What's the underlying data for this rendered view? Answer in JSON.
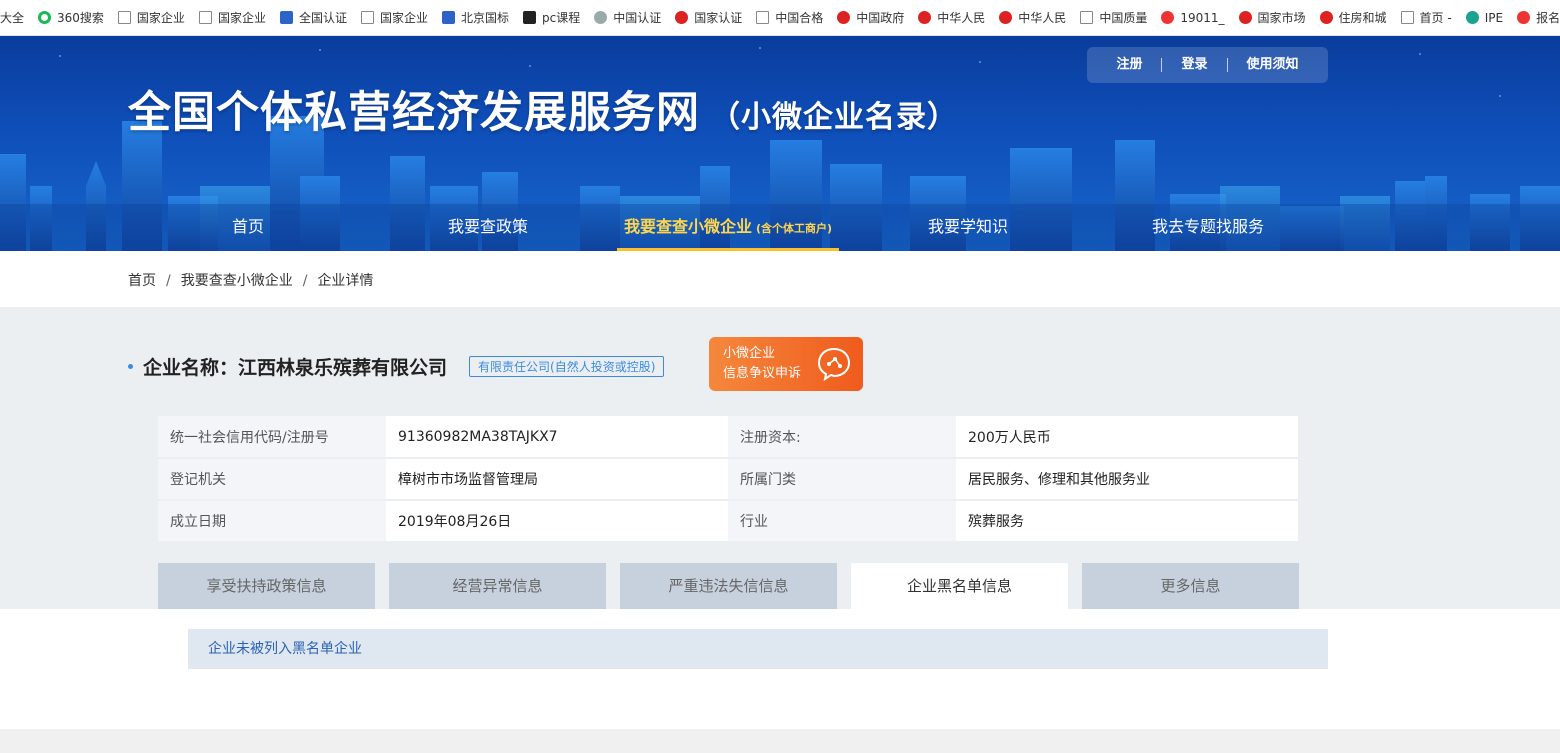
{
  "bookmarks": [
    {
      "label": "大全",
      "icon": "none-icon"
    },
    {
      "label": "360搜索",
      "icon": "360-icon"
    },
    {
      "label": "国家企业",
      "icon": "page-icon"
    },
    {
      "label": "国家企业",
      "icon": "page-icon"
    },
    {
      "label": "全国认证",
      "icon": "blue-icon"
    },
    {
      "label": "国家企业",
      "icon": "page-icon"
    },
    {
      "label": "北京国标",
      "icon": "blue-icon"
    },
    {
      "label": "pc课程",
      "icon": "dark-icon"
    },
    {
      "label": "中国认证",
      "icon": "grey-icon"
    },
    {
      "label": "国家认证",
      "icon": "seal-icon"
    },
    {
      "label": "中国合格",
      "icon": "page-icon"
    },
    {
      "label": "中国政府",
      "icon": "seal-icon"
    },
    {
      "label": "中华人民",
      "icon": "seal-icon"
    },
    {
      "label": "中华人民",
      "icon": "seal-icon"
    },
    {
      "label": "中国质量",
      "icon": "page-icon"
    },
    {
      "label": "19011_",
      "icon": "red-icon"
    },
    {
      "label": "国家市场",
      "icon": "seal-icon"
    },
    {
      "label": "住房和城",
      "icon": "seal-icon"
    },
    {
      "label": "首页 -",
      "icon": "page-icon"
    },
    {
      "label": "IPE",
      "icon": "teal-icon"
    },
    {
      "label": "报名首",
      "icon": "red-icon"
    }
  ],
  "header": {
    "title": "全国个体私营经济发展服务网",
    "subtitle": "（小微企业名录）",
    "toplinks": {
      "register": "注册",
      "login": "登录",
      "guide": "使用须知"
    }
  },
  "nav": {
    "home": "首页",
    "policy": "我要查政策",
    "enterprise": "我要查查小微企业",
    "enterprise_note": "(含个体工商户)",
    "learn": "我要学知识",
    "topic": "我去专题找服务"
  },
  "breadcrumb": {
    "home": "首页",
    "search": "我要查查小微企业",
    "detail": "企业详情"
  },
  "company": {
    "label": "企业名称：江西林泉乐殡葬有限公司",
    "type": "有限责任公司(自然人投资或控股)",
    "appeal_line1": "小微企业",
    "appeal_line2": "信息争议申诉"
  },
  "info": {
    "credit_code_label": "统一社会信用代码/注册号",
    "credit_code_value": "91360982MA38TAJKX7",
    "capital_label": "注册资本:",
    "capital_value": "200万人民币",
    "authority_label": "登记机关",
    "authority_value": "樟树市市场监督管理局",
    "category_label": "所属门类",
    "category_value": "居民服务、修理和其他服务业",
    "date_label": "成立日期",
    "date_value": "2019年08月26日",
    "industry_label": "行业",
    "industry_value": "殡葬服务"
  },
  "tabs": {
    "support": "享受扶持政策信息",
    "abnormal": "经营异常信息",
    "illegal": "严重违法失信信息",
    "blacklist": "企业黑名单信息",
    "more": "更多信息",
    "active": "blacklist"
  },
  "notice": {
    "text": "企业未被列入黑名单企业"
  },
  "colors": {
    "accent": "#3c8be0",
    "nav_active": "#ffd64d",
    "appeal": "#f05b1c"
  }
}
